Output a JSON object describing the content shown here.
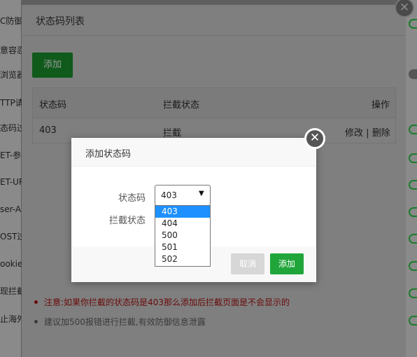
{
  "background": {
    "left_labels": [
      "C防御",
      "意容忍",
      "浏览器",
      "TTP请",
      "态码过",
      "ET-参",
      "ET-UR",
      "ser-Ag",
      "OST过",
      "ookie",
      "现拦截",
      "止海外"
    ]
  },
  "outer_dialog": {
    "title": "状态码列表",
    "add_button": "添加",
    "table": {
      "headers": [
        "状态码",
        "拦截状态",
        "操作"
      ],
      "rows": [
        {
          "code": "403",
          "status": "拦截",
          "edit": "修改",
          "sep": "|",
          "delete": "删除"
        }
      ]
    },
    "notes": [
      "注意:如果你拦截的状态码是403那么添加后拦截页面是不会显示的",
      "建议加500报错进行拦截,有效防御信息泄露"
    ]
  },
  "add_dialog": {
    "title": "添加状态码",
    "status_code_label": "状态码",
    "intercept_status_label": "拦截状态",
    "selected_value": "403",
    "options": [
      "403",
      "404",
      "500",
      "501",
      "502"
    ],
    "cancel_button": "取消",
    "confirm_button": "添加"
  },
  "icons": {
    "close": "close-icon",
    "chevron": "chevron-down-icon"
  },
  "colors": {
    "accent": "#20a53a",
    "selected_option": "#1e90ff",
    "warning_text": "#cc0000"
  }
}
